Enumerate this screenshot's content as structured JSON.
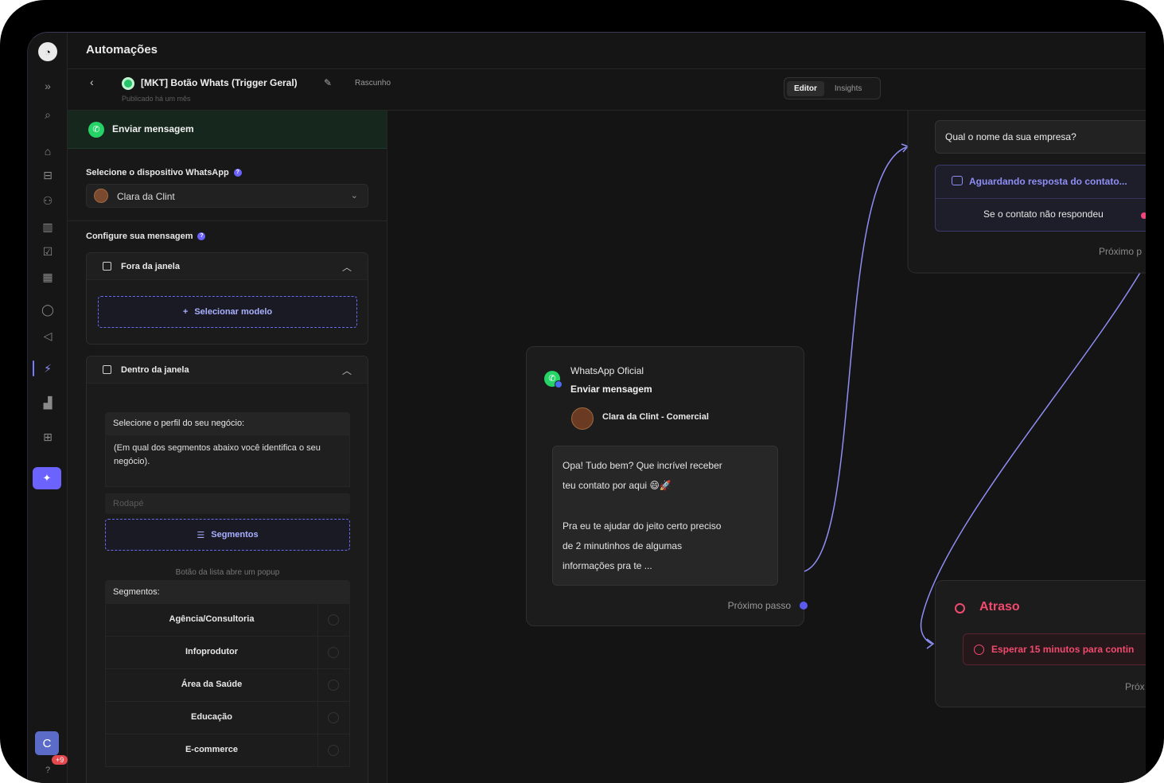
{
  "app": {
    "title": "Automações"
  },
  "flow": {
    "back_icon": "‹",
    "name": "[MKT] Botão Whats (Trigger Geral)",
    "status": "Rascunho",
    "published": "Publicado há um mês"
  },
  "view_toggle": {
    "editor": "Editor",
    "insights": "Insights",
    "active": "Editor"
  },
  "rail": {
    "expand": "»",
    "icons": [
      "search-icon",
      "home-icon",
      "pipeline-icon",
      "contacts-icon",
      "companies-icon",
      "tasks-icon",
      "calendar-icon",
      "chat-icon",
      "campaign-icon",
      "automations-icon",
      "reports-icon",
      "apps-icon",
      "ai-icon"
    ],
    "user_initial": "C",
    "badge": "+9",
    "help": "?"
  },
  "panel": {
    "header": "Enviar mensagem",
    "device_label": "Selecione o dispositivo WhatsApp",
    "device_value": "Clara da Clint",
    "message_label": "Configure sua mensagem",
    "outside_window": "Fora da janela",
    "select_template": "Selecionar modelo",
    "inside_window": "Dentro da janela",
    "question_title": "Selecione o perfil do seu negócio:",
    "question_body": "(Em qual dos segmentos abaixo você identifica o seu negócio).",
    "footer_placeholder": "Rodapé",
    "segments_button": "Segmentos",
    "hint": "Botão da lista abre um popup",
    "segments_header": "Segmentos:",
    "segments": [
      "Agência/Consultoria",
      "Infoprodutor",
      "Área da Saúde",
      "Educação",
      "E-commerce"
    ]
  },
  "node": {
    "channel": "WhatsApp Oficial",
    "action": "Enviar mensagem",
    "device": "Clara da Clint - Comercial",
    "message_lines": [
      "Opa! Tudo bem? Que incrível receber",
      "teu contato por aqui 😄🚀",
      "",
      "Pra eu te ajudar do jeito certo preciso",
      "de 2 minutinhos de algumas",
      "informações pra te ..."
    ],
    "next": "Próximo passo"
  },
  "right_node": {
    "question": "Qual o nome da sua empresa?",
    "waiting": "Aguardando resposta do contato...",
    "no_reply": "Se o contato não respondeu",
    "next": "Próximo p"
  },
  "delay_node": {
    "title": "Atraso",
    "wait": "Esperar 15 minutos para contin",
    "next": "Próx"
  },
  "colors": {
    "accent": "#6c63ff",
    "whatsapp": "#25d366",
    "delay": "#f24a6e"
  }
}
